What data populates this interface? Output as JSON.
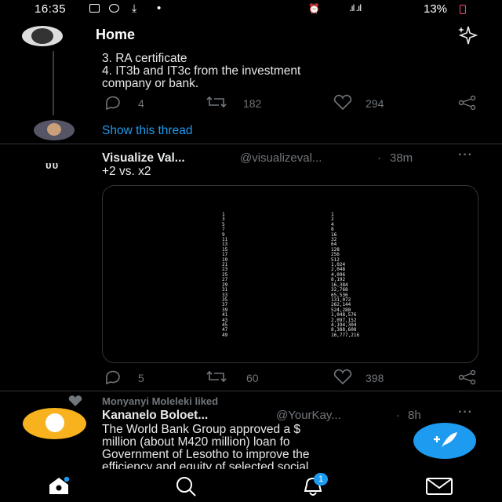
{
  "status_bar": {
    "time": "16:35",
    "dot": "•",
    "battery": "13%",
    "icons": [
      "image-icon",
      "whatsapp-icon",
      "download-icon",
      "alarm-icon",
      "mute-icon",
      "signal-icon",
      "battery-icon"
    ]
  },
  "header": {
    "title": "Home",
    "sparkle_icon": "sparkle-icon"
  },
  "tweet1": {
    "lines": [
      "3. RA certificate",
      "4. IT3b and IT3c from the investment",
      "company or bank."
    ],
    "replies": "4",
    "retweets": "182",
    "likes": "294",
    "show_thread": "Show this thread"
  },
  "tweet2": {
    "name": "Visualize Val...",
    "handle": "@visualizeval...",
    "dot": "·",
    "time": "38m",
    "text": "+2 vs. x2",
    "left_column": [
      "1",
      "3",
      "5",
      "7",
      "9",
      "11",
      "13",
      "15",
      "17",
      "19",
      "21",
      "23",
      "25",
      "27",
      "29",
      "31",
      "33",
      "35",
      "37",
      "39",
      "41",
      "43",
      "45",
      "47",
      "49"
    ],
    "right_column": [
      "1",
      "2",
      "4",
      "8",
      "16",
      "32",
      "64",
      "128",
      "256",
      "512",
      "1,024",
      "2,048",
      "4,096",
      "8,192",
      "16,384",
      "32,768",
      "65,536",
      "131,072",
      "262,144",
      "524,288",
      "1,048,576",
      "2,097,152",
      "4,194,304",
      "8,388,608",
      "16,777,216"
    ],
    "replies": "5",
    "retweets": "60",
    "likes": "398"
  },
  "tweet3": {
    "liked_by": "Monyanyi Moleleki liked",
    "name": "Kananelo Boloet...",
    "handle": "@YourKay...",
    "dot": "·",
    "time": "8h",
    "lines": [
      "The World Bank Group approved a $",
      "million (about M420 million) loan fo",
      "Government of Lesotho to improve the",
      "efficiency and equity of selected social"
    ]
  },
  "bottom_nav": {
    "notifications_badge": "1"
  },
  "colors": {
    "accent": "#1d9bf0",
    "muted": "#71767b",
    "background": "#000000"
  }
}
